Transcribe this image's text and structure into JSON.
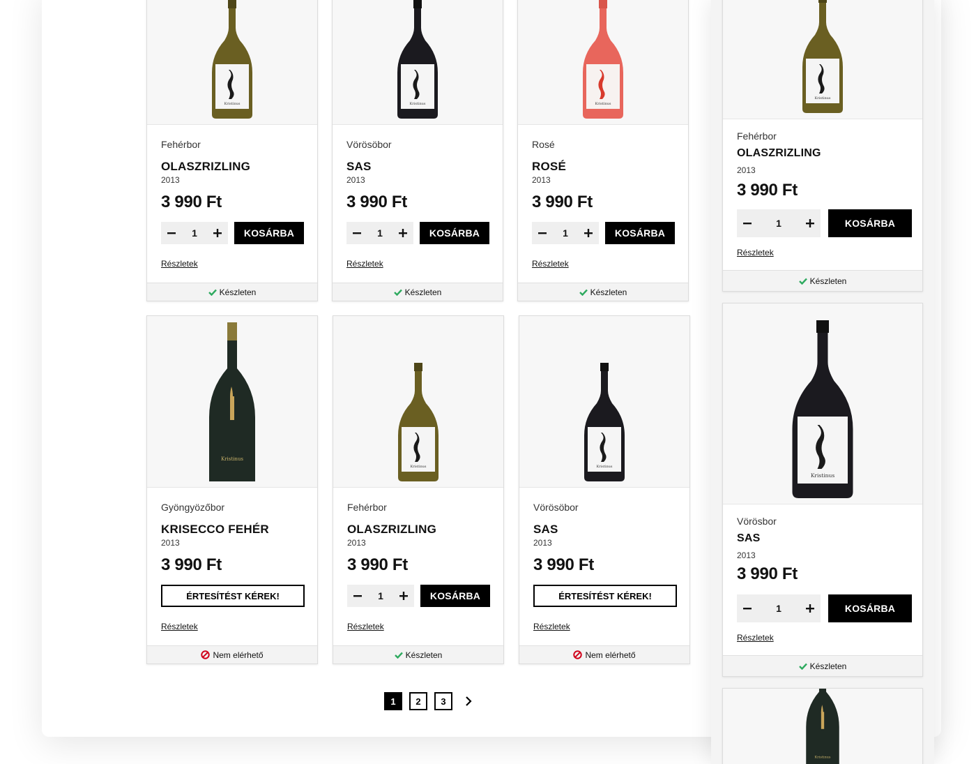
{
  "colors": {
    "accent": "#000000",
    "in_stock": "#2eaa5f",
    "unavailable": "#d0021b"
  },
  "actions": {
    "add_to_cart": "KOSÁRBA",
    "notify": "ÉRTESÍTÉST KÉREK!",
    "details": "Részletek",
    "minus_icon": "minus-icon",
    "plus_icon": "plus-icon"
  },
  "stock_labels": {
    "in_stock": "Készleten",
    "unavailable": "Nem elérhető"
  },
  "grid": {
    "row1": [
      {
        "category": "Fehérbor",
        "name": "OLASZRIZLING",
        "year": "2013",
        "price": "3 990 Ft",
        "qty": "1",
        "bottle": "white",
        "available": true
      },
      {
        "category": "Vörösöbor",
        "name": "SAS",
        "year": "2013",
        "price": "3 990 Ft",
        "qty": "1",
        "bottle": "red",
        "available": true
      },
      {
        "category": "Rosé",
        "name": "ROSÉ",
        "year": "2013",
        "price": "3 990 Ft",
        "qty": "1",
        "bottle": "rose",
        "available": true
      }
    ],
    "row2": [
      {
        "category": "Gyöngyözőbor",
        "name": "KRISECCO FEHÉR",
        "year": "2013",
        "price": "3 990 Ft",
        "qty": "1",
        "bottle": "sparkling",
        "available": false
      },
      {
        "category": "Fehérbor",
        "name": "OLASZRIZLING",
        "year": "2013",
        "price": "3 990 Ft",
        "qty": "1",
        "bottle": "white",
        "available": true
      },
      {
        "category": "Vörösöbor",
        "name": "SAS",
        "year": "2013",
        "price": "3 990 Ft",
        "qty": "1",
        "bottle": "red",
        "available": false
      }
    ]
  },
  "pagination": {
    "pages": [
      "1",
      "2",
      "3"
    ],
    "current": "1",
    "next_icon": "chevron-right-icon"
  },
  "side": [
    {
      "category": "Fehérbor",
      "name": "OLASZRIZLING",
      "year": "2013",
      "price": "3 990 Ft",
      "qty": "1",
      "bottle": "white",
      "available": true
    },
    {
      "category": "Vörösbor",
      "name": "SAS",
      "year": "2013",
      "price": "3 990 Ft",
      "qty": "1",
      "bottle": "red",
      "available": true
    },
    {
      "bottle": "sparkling"
    }
  ]
}
